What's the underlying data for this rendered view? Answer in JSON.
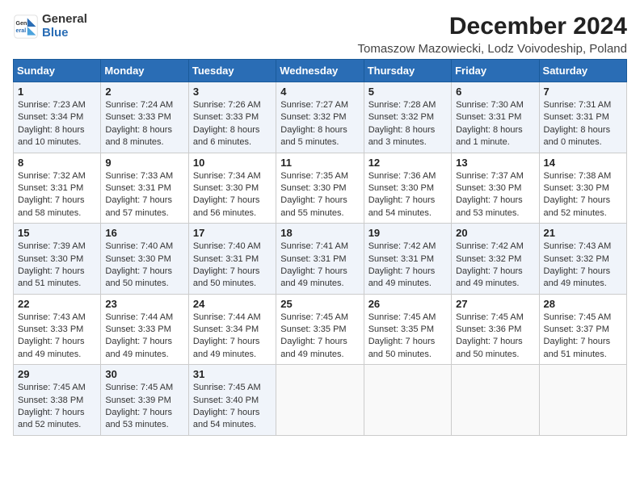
{
  "logo": {
    "general": "General",
    "blue": "Blue"
  },
  "title": "December 2024",
  "subtitle": "Tomaszow Mazowiecki, Lodz Voivodeship, Poland",
  "days_of_week": [
    "Sunday",
    "Monday",
    "Tuesday",
    "Wednesday",
    "Thursday",
    "Friday",
    "Saturday"
  ],
  "weeks": [
    [
      {
        "day": "1",
        "sunrise": "7:23 AM",
        "sunset": "3:34 PM",
        "daylight": "8 hours and 10 minutes."
      },
      {
        "day": "2",
        "sunrise": "7:24 AM",
        "sunset": "3:33 PM",
        "daylight": "8 hours and 8 minutes."
      },
      {
        "day": "3",
        "sunrise": "7:26 AM",
        "sunset": "3:33 PM",
        "daylight": "8 hours and 6 minutes."
      },
      {
        "day": "4",
        "sunrise": "7:27 AM",
        "sunset": "3:32 PM",
        "daylight": "8 hours and 5 minutes."
      },
      {
        "day": "5",
        "sunrise": "7:28 AM",
        "sunset": "3:32 PM",
        "daylight": "8 hours and 3 minutes."
      },
      {
        "day": "6",
        "sunrise": "7:30 AM",
        "sunset": "3:31 PM",
        "daylight": "8 hours and 1 minute."
      },
      {
        "day": "7",
        "sunrise": "7:31 AM",
        "sunset": "3:31 PM",
        "daylight": "8 hours and 0 minutes."
      }
    ],
    [
      {
        "day": "8",
        "sunrise": "7:32 AM",
        "sunset": "3:31 PM",
        "daylight": "7 hours and 58 minutes."
      },
      {
        "day": "9",
        "sunrise": "7:33 AM",
        "sunset": "3:31 PM",
        "daylight": "7 hours and 57 minutes."
      },
      {
        "day": "10",
        "sunrise": "7:34 AM",
        "sunset": "3:30 PM",
        "daylight": "7 hours and 56 minutes."
      },
      {
        "day": "11",
        "sunrise": "7:35 AM",
        "sunset": "3:30 PM",
        "daylight": "7 hours and 55 minutes."
      },
      {
        "day": "12",
        "sunrise": "7:36 AM",
        "sunset": "3:30 PM",
        "daylight": "7 hours and 54 minutes."
      },
      {
        "day": "13",
        "sunrise": "7:37 AM",
        "sunset": "3:30 PM",
        "daylight": "7 hours and 53 minutes."
      },
      {
        "day": "14",
        "sunrise": "7:38 AM",
        "sunset": "3:30 PM",
        "daylight": "7 hours and 52 minutes."
      }
    ],
    [
      {
        "day": "15",
        "sunrise": "7:39 AM",
        "sunset": "3:30 PM",
        "daylight": "7 hours and 51 minutes."
      },
      {
        "day": "16",
        "sunrise": "7:40 AM",
        "sunset": "3:30 PM",
        "daylight": "7 hours and 50 minutes."
      },
      {
        "day": "17",
        "sunrise": "7:40 AM",
        "sunset": "3:31 PM",
        "daylight": "7 hours and 50 minutes."
      },
      {
        "day": "18",
        "sunrise": "7:41 AM",
        "sunset": "3:31 PM",
        "daylight": "7 hours and 49 minutes."
      },
      {
        "day": "19",
        "sunrise": "7:42 AM",
        "sunset": "3:31 PM",
        "daylight": "7 hours and 49 minutes."
      },
      {
        "day": "20",
        "sunrise": "7:42 AM",
        "sunset": "3:32 PM",
        "daylight": "7 hours and 49 minutes."
      },
      {
        "day": "21",
        "sunrise": "7:43 AM",
        "sunset": "3:32 PM",
        "daylight": "7 hours and 49 minutes."
      }
    ],
    [
      {
        "day": "22",
        "sunrise": "7:43 AM",
        "sunset": "3:33 PM",
        "daylight": "7 hours and 49 minutes."
      },
      {
        "day": "23",
        "sunrise": "7:44 AM",
        "sunset": "3:33 PM",
        "daylight": "7 hours and 49 minutes."
      },
      {
        "day": "24",
        "sunrise": "7:44 AM",
        "sunset": "3:34 PM",
        "daylight": "7 hours and 49 minutes."
      },
      {
        "day": "25",
        "sunrise": "7:45 AM",
        "sunset": "3:35 PM",
        "daylight": "7 hours and 49 minutes."
      },
      {
        "day": "26",
        "sunrise": "7:45 AM",
        "sunset": "3:35 PM",
        "daylight": "7 hours and 50 minutes."
      },
      {
        "day": "27",
        "sunrise": "7:45 AM",
        "sunset": "3:36 PM",
        "daylight": "7 hours and 50 minutes."
      },
      {
        "day": "28",
        "sunrise": "7:45 AM",
        "sunset": "3:37 PM",
        "daylight": "7 hours and 51 minutes."
      }
    ],
    [
      {
        "day": "29",
        "sunrise": "7:45 AM",
        "sunset": "3:38 PM",
        "daylight": "7 hours and 52 minutes."
      },
      {
        "day": "30",
        "sunrise": "7:45 AM",
        "sunset": "3:39 PM",
        "daylight": "7 hours and 53 minutes."
      },
      {
        "day": "31",
        "sunrise": "7:45 AM",
        "sunset": "3:40 PM",
        "daylight": "7 hours and 54 minutes."
      },
      null,
      null,
      null,
      null
    ]
  ]
}
